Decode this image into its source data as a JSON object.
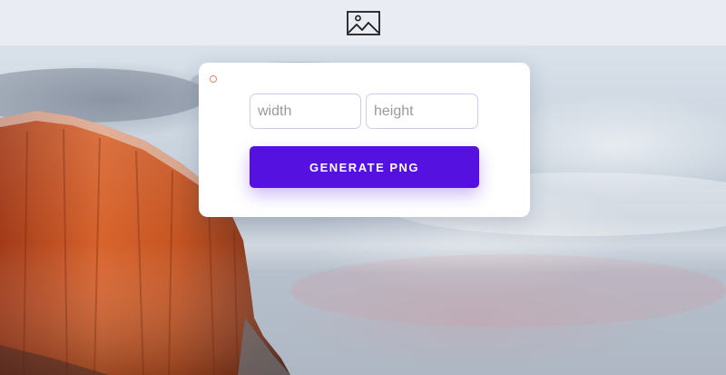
{
  "header": {
    "icon": "image-icon"
  },
  "form": {
    "status_icon": "circle-outline-icon",
    "width_placeholder": "width",
    "height_placeholder": "height",
    "width_value": "",
    "height_value": "",
    "generate_label": "GENERATE PNG"
  },
  "colors": {
    "button": "#5411e0",
    "input_border": "#c9cdf0",
    "status_dot": "#e08a6c",
    "topbar": "#e9edf3"
  }
}
